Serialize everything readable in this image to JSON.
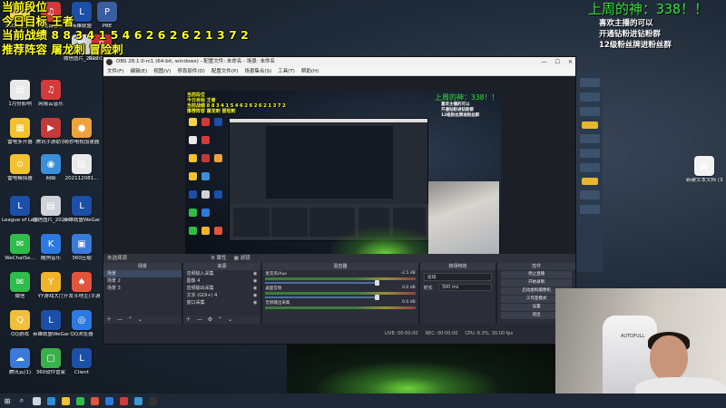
{
  "overlay": {
    "left_lines": [
      "当前段位",
      "今日目标 王者",
      "当前战绩 8 8 3 4 1 5 4 6 2 6 2 6 2 1 3 7 2",
      "推荐阵容 屠龙刺 冒险刺"
    ],
    "god_title": "上周的神：338！！",
    "right_lines": [
      "喜欢主播的可以",
      "开通钻粉进钻粉群",
      "12级粉丝牌进粉丝群"
    ]
  },
  "desktop": {
    "icons": [
      {
        "label": "360安全卫士",
        "color": "#f3d34a",
        "glyph": "♦"
      },
      {
        "label": "网易云音乐",
        "color": "#d43a3a",
        "glyph": "♫"
      },
      {
        "label": "英雄联盟",
        "color": "#1b4fa8",
        "glyph": "L"
      },
      {
        "label": "微信图片_2022042...",
        "color": "#cfd3d8",
        "glyph": "▤"
      },
      {
        "label": "Riot Client",
        "color": "#cc2e2e",
        "glyph": "R"
      },
      {
        "label": "PBE",
        "color": "#3a5ea0",
        "glyph": "P"
      },
      {
        "label": "1月份影响",
        "color": "#e9e9e9",
        "glyph": "▤"
      },
      {
        "label": "网易云音乐",
        "color": "#d43a3a",
        "glyph": "♫"
      },
      {
        "label": "雷电多开器",
        "color": "#f2c230",
        "glyph": "▦"
      },
      {
        "label": "腾讯手游助手",
        "color": "#c23a3a",
        "glyph": "▶"
      },
      {
        "label": "奇妙电视加速器",
        "color": "#f0a23a",
        "glyph": "●"
      },
      {
        "label": "雷电模拟器",
        "color": "#f2c230",
        "glyph": "⊙"
      },
      {
        "label": "网络",
        "color": "#3a8fd8",
        "glyph": "◉"
      },
      {
        "label": "202112081...",
        "color": "#e9e9e9",
        "glyph": "▤"
      },
      {
        "label": "League of Legends",
        "color": "#1b4fa8",
        "glyph": "L"
      },
      {
        "label": "微信图片_2022051...",
        "color": "#cfd3d8",
        "glyph": "▤"
      },
      {
        "label": "英雄联盟WeGame版",
        "color": "#1b4fa8",
        "glyph": "L"
      },
      {
        "label": "WeChatSe...",
        "color": "#2fbd4a",
        "glyph": "✉"
      },
      {
        "label": "酷狗音乐",
        "color": "#2a7ae2",
        "glyph": "K"
      },
      {
        "label": "360压缩",
        "color": "#3a7ad8",
        "glyph": "▣"
      },
      {
        "label": "微信",
        "color": "#2fbd4a",
        "glyph": "✉"
      },
      {
        "label": "YY游戏大厅",
        "color": "#f0b42a",
        "glyph": "Y"
      },
      {
        "label": "开发斗地主(手游平台)",
        "color": "#e2553a",
        "glyph": "♠"
      },
      {
        "label": "QQ游戏",
        "color": "#f0c03a",
        "glyph": "Q"
      },
      {
        "label": "英雄联盟WeGame版",
        "color": "#1b4fa8",
        "glyph": "L"
      },
      {
        "label": "QQ浏览器",
        "color": "#2a7ae2",
        "glyph": "◎"
      },
      {
        "label": "腾讯云(1)",
        "color": "#3a7ad8",
        "glyph": "☁"
      },
      {
        "label": "360软件管家",
        "color": "#3ab04a",
        "glyph": "▢"
      },
      {
        "label": "Client",
        "color": "#1b4fa8",
        "glyph": "L"
      },
      {
        "label": "新建文本文档 (3)",
        "color": "#f2f2f2",
        "glyph": "▤"
      }
    ]
  },
  "obs": {
    "title": "OBS 28.1.0-rc1 (64-bit, windows) - 配置文件: 未命名 - 场景: 未命名",
    "menu": [
      "文件(F)",
      "编辑(E)",
      "视图(V)",
      "停靠部件(D)",
      "配置文件(P)",
      "场景集合(S)",
      "工具(T)",
      "帮助(H)"
    ],
    "scenebar_label": "未选择源",
    "scenebar_buttons": [
      "⚙ 属性",
      "▦ 滤镜"
    ],
    "docks": {
      "scenes": {
        "title": "场景",
        "items": [
          "场景",
          "场景 2",
          "场景 3"
        ]
      },
      "sources": {
        "title": "来源",
        "items": [
          "音频输入采集",
          "图像 4",
          "音频输出采集",
          "文本 (GDI+) 4",
          "窗口采集",
          "文本 (GDI+) 3"
        ]
      },
      "mixer": {
        "title": "混音器",
        "rows": [
          {
            "name": "麦克风/Aux",
            "db": "-2.5 dB"
          },
          {
            "name": "桌面音频",
            "db": "0.0 dB"
          },
          {
            "name": "音频输出采集",
            "db": "0.0 dB"
          }
        ]
      },
      "transitions": {
        "title": "转场特效",
        "current": "淡出",
        "duration_label": "时长",
        "duration_value": "300 ms"
      },
      "controls": {
        "title": "控件",
        "buttons": [
          "停止直播",
          "开始录制",
          "启动虚拟摄像机",
          "工作室模式",
          "设置",
          "退出"
        ]
      }
    },
    "status": {
      "live": "LIVE: 00:00:00",
      "rec": "REC: 00:00:00",
      "cpu": "CPU: 6.3%, 30.00 fps"
    }
  },
  "preview": {
    "left_text": [
      "当前段位",
      "今日目标 王者",
      "当前战绩 8 8 3 4 1 5 4 6 2 6 2 6 2 1 3 7 2",
      "推荐阵容 屠龙刺 冒险刺"
    ],
    "god_title": "上周的神：338！！",
    "right_lines": [
      "喜欢主播的可以",
      "开通钻粉进钻粉群",
      "12级粉丝牌进粉丝群"
    ]
  },
  "webcam": {
    "brand": "AUTOFULL"
  },
  "taskbar": {
    "start_glyph": "⊞",
    "search_glyph": "⌕",
    "items": [
      {
        "name": "task-view",
        "color": "#cfd6e0"
      },
      {
        "name": "edge",
        "color": "#2a8fd8"
      },
      {
        "name": "explorer",
        "color": "#f2c230"
      },
      {
        "name": "wechat",
        "color": "#2fbd4a"
      },
      {
        "name": "store",
        "color": "#e2553a"
      },
      {
        "name": "browser",
        "color": "#2a7ae2"
      },
      {
        "name": "netease",
        "color": "#d43a3a"
      },
      {
        "name": "qq",
        "color": "#3a9ad8"
      },
      {
        "name": "obs",
        "color": "#333333"
      }
    ]
  }
}
